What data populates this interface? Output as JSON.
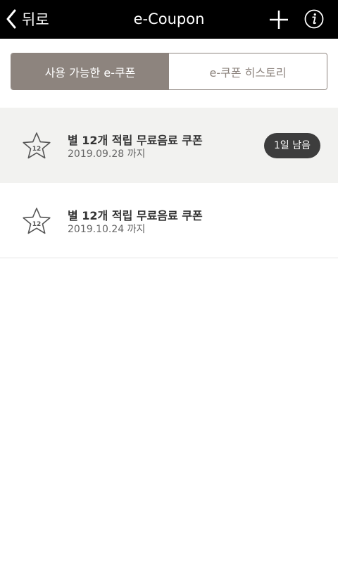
{
  "header": {
    "back_label": "뒤로",
    "title": "e-Coupon"
  },
  "tabs": [
    {
      "label": "사용 가능한 e-쿠폰",
      "active": true
    },
    {
      "label": "e-쿠폰 히스토리",
      "active": false
    }
  ],
  "coupons": [
    {
      "star_number": "12",
      "name": "별 12개 적립 무료음료 쿠폰",
      "expiry": "2019.09.28 까지",
      "badge": "1일 남음"
    },
    {
      "star_number": "12",
      "name": "별 12개 적립 무료음료 쿠폰",
      "expiry": "2019.10.24 까지"
    }
  ],
  "colors": {
    "header_bg": "#000000",
    "tab_active": "#8d847e",
    "badge_bg": "#3d3d3d",
    "highlight_row": "#f2f2f0"
  },
  "icons": [
    "chevron-left-icon",
    "plus-icon",
    "info-icon",
    "star-icon"
  ]
}
